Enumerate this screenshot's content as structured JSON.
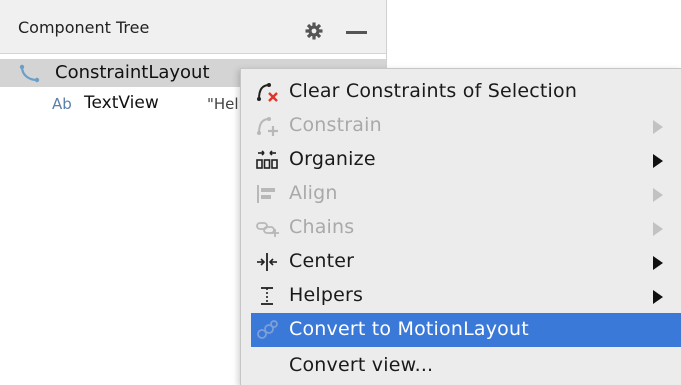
{
  "panel": {
    "title": "Component Tree",
    "header_icons": [
      "gear-icon",
      "minus-icon"
    ],
    "tree": {
      "root": {
        "label": "ConstraintLayout",
        "icon": "constraint-layout-icon",
        "selected": true
      },
      "child": {
        "label": "TextView",
        "icon_text": "Ab",
        "value": "\"Hello"
      }
    }
  },
  "context_menu": {
    "items": [
      {
        "label": "Clear Constraints of Selection",
        "icon": "clear-constraints-icon",
        "enabled": true,
        "submenu": false
      },
      {
        "label": "Constrain",
        "icon": "constrain-icon",
        "enabled": false,
        "submenu": true
      },
      {
        "label": "Organize",
        "icon": "organize-icon",
        "enabled": true,
        "submenu": true
      },
      {
        "label": "Align",
        "icon": "align-icon",
        "enabled": false,
        "submenu": true
      },
      {
        "label": "Chains",
        "icon": "chains-icon",
        "enabled": false,
        "submenu": true
      },
      {
        "label": "Center",
        "icon": "center-icon",
        "enabled": true,
        "submenu": true
      },
      {
        "label": "Helpers",
        "icon": "helpers-icon",
        "enabled": true,
        "submenu": true
      },
      {
        "label": "Convert to MotionLayout",
        "icon": "motion-layout-icon",
        "enabled": true,
        "submenu": false,
        "highlighted": true
      },
      {
        "label": "Convert view...",
        "icon": "",
        "enabled": true,
        "submenu": false
      }
    ]
  },
  "colors": {
    "highlight": "#3a79d8",
    "menu_bg": "#ececec",
    "selected_row": "#d4d4d4",
    "disabled_text": "#a9a9a9",
    "clear_x": "#e0352b"
  }
}
